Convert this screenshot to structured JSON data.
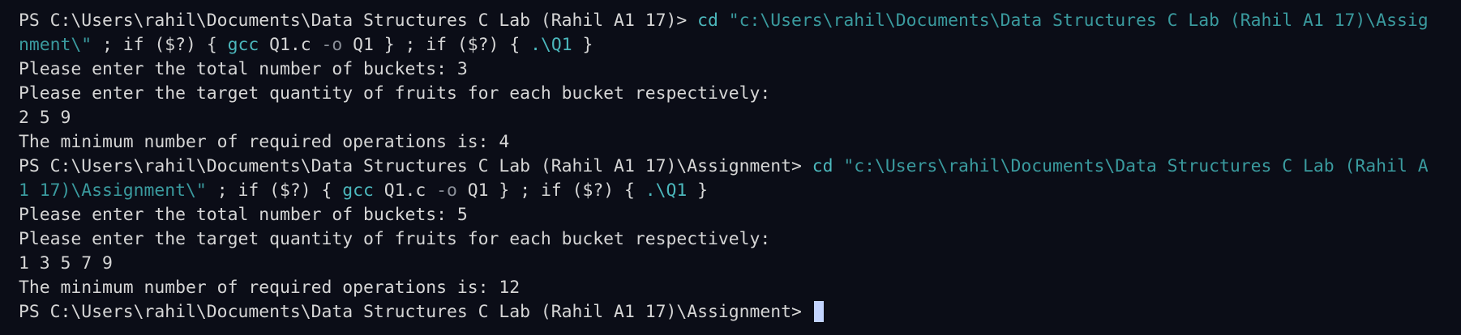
{
  "terminal": {
    "lines": [
      {
        "segments": [
          {
            "text": "PS C:\\Users\\rahil\\Documents\\Data Structures C Lab (Rahil A1 17)> ",
            "style": "cmd"
          },
          {
            "text": "cd ",
            "style": "tok-cyan"
          },
          {
            "text": "\"c:\\Users\\rahil\\Documents\\Data Structures C Lab (Rahil A1 17)\\Assig",
            "style": "str"
          }
        ]
      },
      {
        "segments": [
          {
            "text": "nment\\\"",
            "style": "str"
          },
          {
            "text": " ; if ($?) { ",
            "style": "cmd"
          },
          {
            "text": "gcc ",
            "style": "tok-cyan"
          },
          {
            "text": "Q1.c ",
            "style": "cmd"
          },
          {
            "text": "-o ",
            "style": "tok-gray"
          },
          {
            "text": "Q1 } ; if ($?) { ",
            "style": "cmd"
          },
          {
            "text": ".\\Q1",
            "style": "tok-cyan"
          },
          {
            "text": " }",
            "style": "cmd"
          }
        ]
      },
      {
        "segments": [
          {
            "text": "Please enter the total number of buckets: 3",
            "style": "cmd"
          }
        ]
      },
      {
        "segments": [
          {
            "text": "Please enter the target quantity of fruits for each bucket respectively:",
            "style": "cmd"
          }
        ]
      },
      {
        "segments": [
          {
            "text": "2 5 9",
            "style": "cmd"
          }
        ]
      },
      {
        "segments": [
          {
            "text": "The minimum number of required operations is: 4",
            "style": "cmd"
          }
        ]
      },
      {
        "segments": [
          {
            "text": "PS C:\\Users\\rahil\\Documents\\Data Structures C Lab (Rahil A1 17)\\Assignment> ",
            "style": "cmd"
          },
          {
            "text": "cd ",
            "style": "tok-cyan"
          },
          {
            "text": "\"c:\\Users\\rahil\\Documents\\Data Structures C Lab (Rahil A",
            "style": "str"
          }
        ]
      },
      {
        "segments": [
          {
            "text": "1 17)\\Assignment\\\"",
            "style": "str"
          },
          {
            "text": " ; if ($?) { ",
            "style": "cmd"
          },
          {
            "text": "gcc ",
            "style": "tok-cyan"
          },
          {
            "text": "Q1.c ",
            "style": "cmd"
          },
          {
            "text": "-o ",
            "style": "tok-gray"
          },
          {
            "text": "Q1 } ; if ($?) { ",
            "style": "cmd"
          },
          {
            "text": ".\\Q1",
            "style": "tok-cyan"
          },
          {
            "text": " }",
            "style": "cmd"
          }
        ]
      },
      {
        "segments": [
          {
            "text": "Please enter the total number of buckets: 5",
            "style": "cmd"
          }
        ]
      },
      {
        "segments": [
          {
            "text": "Please enter the target quantity of fruits for each bucket respectively:",
            "style": "cmd"
          }
        ]
      },
      {
        "segments": [
          {
            "text": "1 3 5 7 9",
            "style": "cmd"
          }
        ]
      },
      {
        "segments": [
          {
            "text": "The minimum number of required operations is: 12",
            "style": "cmd"
          }
        ]
      },
      {
        "segments": [
          {
            "text": "PS C:\\Users\\rahil\\Documents\\Data Structures C Lab (Rahil A1 17)\\Assignment> ",
            "style": "cmd"
          }
        ],
        "cursor": true
      }
    ]
  }
}
